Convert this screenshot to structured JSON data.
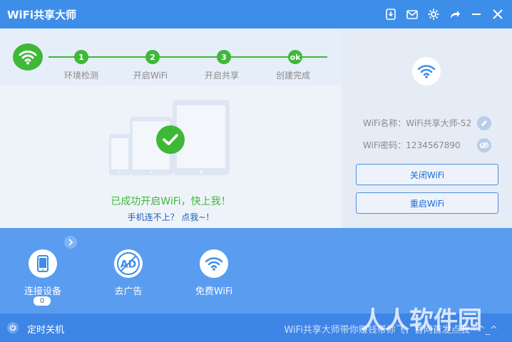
{
  "window": {
    "title": "WiFi共享大师"
  },
  "steps": [
    {
      "num": "1",
      "label": "环境检测"
    },
    {
      "num": "2",
      "label": "开启WiFi"
    },
    {
      "num": "3",
      "label": "开启共享"
    },
    {
      "num": "ok",
      "label": "创建完成"
    }
  ],
  "status": {
    "success_message": "已成功开启WiFi，快上我！",
    "help_link": "手机连不上？ 点我~！"
  },
  "wifi_info": {
    "name_label": "WiFi名称：WiFi共享大师-52",
    "password_label": "WiFi密码：1234567890",
    "close_button": "关闭WiFi",
    "restart_button": "重启WiFi"
  },
  "tools": [
    {
      "label": "连接设备",
      "badge": "0",
      "icon": "phone-icon"
    },
    {
      "label": "去广告",
      "icon": "no-ad-icon"
    },
    {
      "label": "免费WiFi",
      "icon": "wifi-icon"
    }
  ],
  "footer": {
    "timer_label": "定时关机",
    "promo_text": "WiFi共享大师带你赚钱带你飞，官网首发点我~^_^"
  },
  "watermark": "人人软件园",
  "colors": {
    "accent": "#3d8ee8",
    "success": "#3fb838",
    "tools_bg": "#5a9cf0"
  }
}
